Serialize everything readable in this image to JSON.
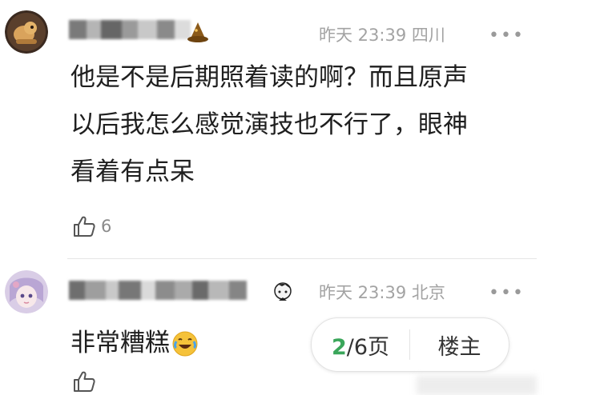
{
  "comments": [
    {
      "time": "昨天 23:39",
      "location": "四川",
      "more": "•••",
      "text_lines": [
        "他是不是后期照着读的啊？而且原声",
        "以后我怎么感觉演技也不行了，眼神",
        "看着有点呆"
      ],
      "likes": "6"
    },
    {
      "time": "昨天 23:39",
      "location": "北京",
      "more": "•••",
      "text": "非常糟糕"
    }
  ],
  "pager": {
    "current": "2",
    "total": "/6页",
    "owner_label": "楼主"
  },
  "icons": {
    "like": "thumbs-up-icon",
    "badge1": "wizard-hat-icon",
    "badge2": "cartoon-face-icon",
    "emoji": "crying-laughing-emoji-icon"
  }
}
